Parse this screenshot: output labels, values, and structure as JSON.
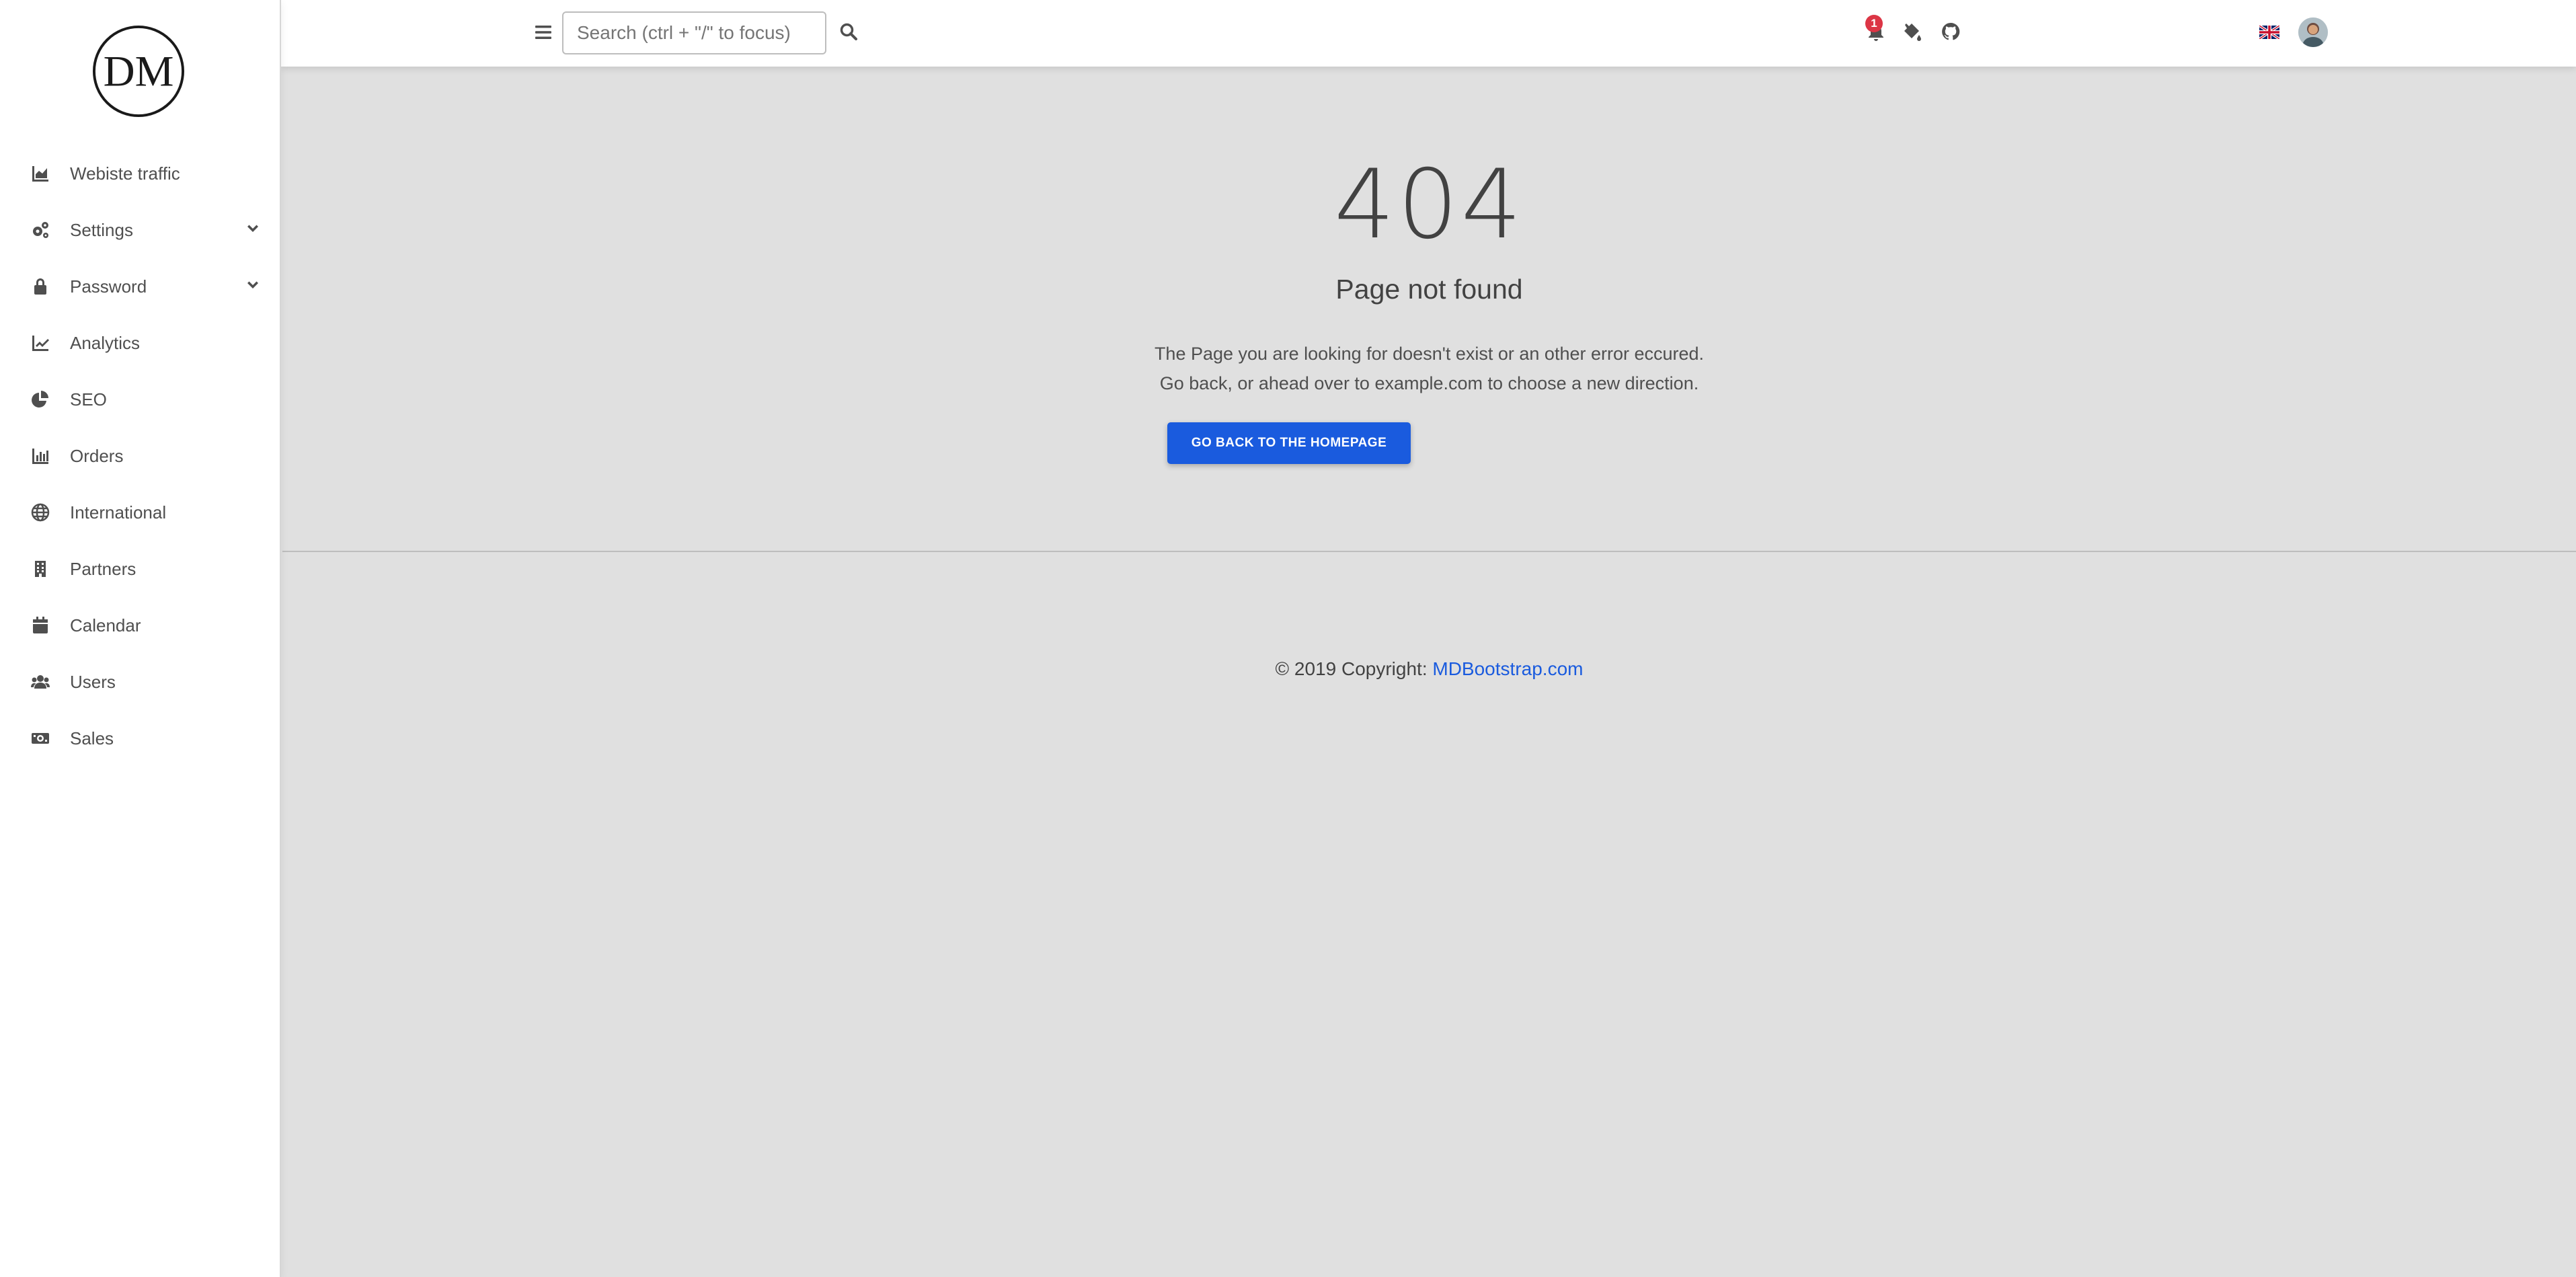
{
  "sidebar": {
    "logo": "DM",
    "items": [
      {
        "label": "Webiste traffic",
        "icon": "chart-area-icon",
        "chevron": false
      },
      {
        "label": "Settings",
        "icon": "cogs-icon",
        "chevron": true
      },
      {
        "label": "Password",
        "icon": "lock-icon",
        "chevron": true
      },
      {
        "label": "Analytics",
        "icon": "chart-line-icon",
        "chevron": false
      },
      {
        "label": "SEO",
        "icon": "chart-pie-icon",
        "chevron": false
      },
      {
        "label": "Orders",
        "icon": "chart-bar-icon",
        "chevron": false
      },
      {
        "label": "International",
        "icon": "globe-icon",
        "chevron": false
      },
      {
        "label": "Partners",
        "icon": "building-icon",
        "chevron": false
      },
      {
        "label": "Calendar",
        "icon": "calendar-icon",
        "chevron": false
      },
      {
        "label": "Users",
        "icon": "users-icon",
        "chevron": false
      },
      {
        "label": "Sales",
        "icon": "money-bill-icon",
        "chevron": false
      }
    ]
  },
  "topbar": {
    "search_placeholder": "Search (ctrl + \"/\" to focus)",
    "notification_count": "1",
    "icons": [
      "bars-icon",
      "search-icon",
      "bell-icon",
      "fill-drip-icon",
      "github-icon",
      "uk-flag-icon",
      "avatar"
    ]
  },
  "error": {
    "code": "404",
    "title": "Page not found",
    "line1": "The Page you are looking for doesn't exist or an other error eccured.",
    "line2": "Go back, or ahead over to example.com to choose a new direction.",
    "button_label": "GO BACK TO THE HOMEPAGE"
  },
  "footer": {
    "prefix": "© 2019 Copyright: ",
    "link_text": "MDBootstrap.com"
  },
  "colors": {
    "primary": "#1a5bde",
    "badge": "#dc3545",
    "background": "#e0e0e0"
  }
}
